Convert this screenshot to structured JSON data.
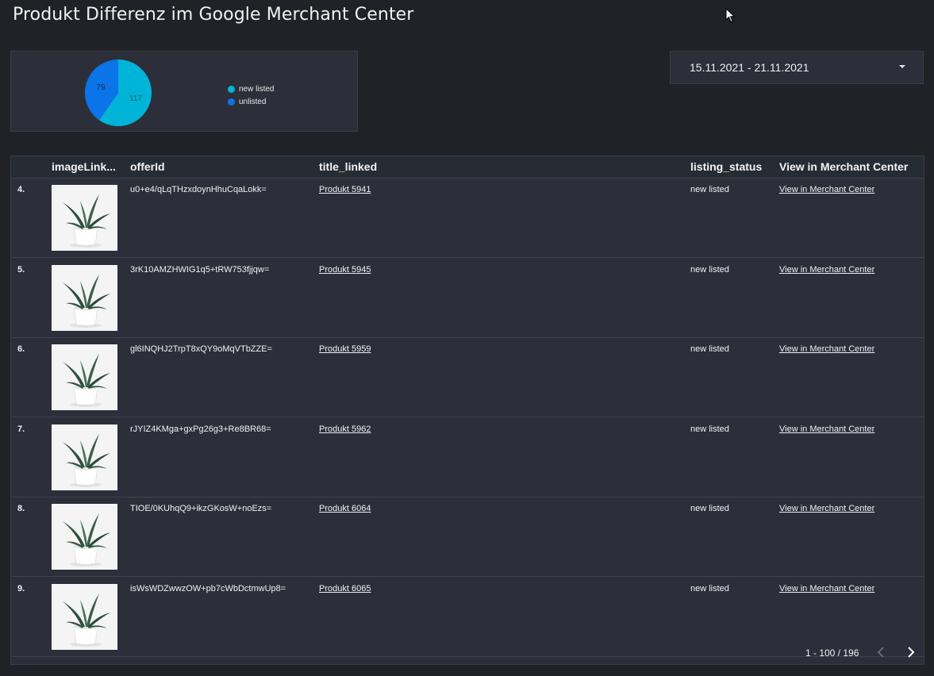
{
  "page": {
    "title": "Produkt Differenz im Google Merchant Center"
  },
  "colors": {
    "background": "#212227",
    "card": "#2c2f3a",
    "new_listed": "#00b4d8",
    "unlisted": "#0a74e8"
  },
  "pie": {
    "slices": [
      {
        "label": "new listed",
        "value": 117,
        "color": "#00b4d8"
      },
      {
        "label": "unlisted",
        "value": 79,
        "color": "#0a74e8"
      }
    ],
    "legend": [
      "new listed",
      "unlisted"
    ]
  },
  "date_range": {
    "value": "15.11.2021 - 21.11.2021",
    "icon": "chevron-down-icon"
  },
  "table": {
    "columns": [
      "imageLink...",
      "offerId",
      "title_linked",
      "listing_status",
      "View in Merchant Center"
    ],
    "rows": [
      {
        "num": "4.",
        "offerId": "u0+e4/qLqTHzxdoynHhuCqaLokk=",
        "title": "Produkt 5941",
        "status": "new listed",
        "link": "View in Merchant Center",
        "image": "plant-thumbnail"
      },
      {
        "num": "5.",
        "offerId": "3rK10AMZHWIG1q5+tRW753fjjqw=",
        "title": "Produkt 5945",
        "status": "new listed",
        "link": "View in Merchant Center",
        "image": "plant-thumbnail"
      },
      {
        "num": "6.",
        "offerId": "gl6INQHJ2TrpT8xQY9oMqVTbZZE=",
        "title": "Produkt 5959",
        "status": "new listed",
        "link": "View in Merchant Center",
        "image": "plant-thumbnail"
      },
      {
        "num": "7.",
        "offerId": "rJYIZ4KMga+gxPg26g3+Re8BR68=",
        "title": "Produkt 5962",
        "status": "new listed",
        "link": "View in Merchant Center",
        "image": "plant-thumbnail"
      },
      {
        "num": "8.",
        "offerId": "TIOE/0KUhqQ9+ikzGKosW+noEzs=",
        "title": "Produkt 6064",
        "status": "new listed",
        "link": "View in Merchant Center",
        "image": "plant-thumbnail"
      },
      {
        "num": "9.",
        "offerId": "isWsWDZwwzOW+pb7cWbDctmwUp8=",
        "title": "Produkt 6065",
        "status": "new listed",
        "link": "View in Merchant Center",
        "image": "plant-thumbnail"
      }
    ]
  },
  "pagination": {
    "info": "1 - 100 / 196",
    "prev_icon": "chevron-left-icon",
    "next_icon": "chevron-right-icon"
  }
}
